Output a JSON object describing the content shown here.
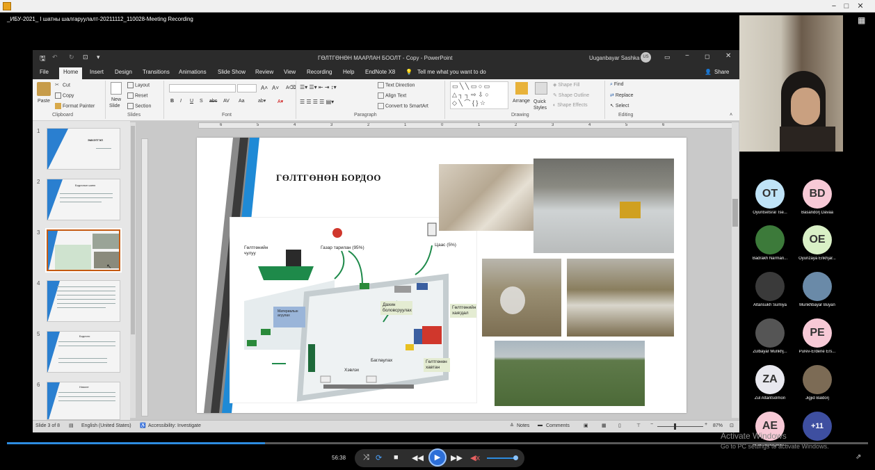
{
  "window": {
    "title_icon": "app-icon",
    "controls": [
      "−",
      "□",
      "✕"
    ]
  },
  "meeting": {
    "title": "_ИБУ-2021_ I шатны шалгаруулалт-20211112_110028-Meeting Recording"
  },
  "ppt": {
    "title": "ГӨЛТГӨНӨН МААРЛАН БООЛТ - Copy - PowerPoint",
    "user": "Uuganbayar Sashka",
    "user_initials": "US",
    "tabs": [
      "File",
      "Home",
      "Insert",
      "Design",
      "Transitions",
      "Animations",
      "Slide Show",
      "Review",
      "View",
      "Recording",
      "Help",
      "EndNote X8"
    ],
    "tell_me": "Tell me what you want to do",
    "share": "Share",
    "ribbon": {
      "clipboard": {
        "paste": "Paste",
        "cut": "Cut",
        "copy": "Copy",
        "format_painter": "Format Painter",
        "group": "Clipboard"
      },
      "slides": {
        "new_slide": "New",
        "new_slide2": "Slide",
        "layout": "Layout",
        "reset": "Reset",
        "section": "Section",
        "group": "Slides"
      },
      "font": {
        "group": "Font",
        "bold": "B",
        "italic": "I",
        "underline": "U",
        "strike": "S",
        "abc": "abc",
        "aa": "Aa"
      },
      "paragraph": {
        "text_direction": "Text Direction",
        "align_text": "Align Text",
        "smartart": "Convert to SmartArt",
        "group": "Paragraph"
      },
      "drawing": {
        "arrange": "Arrange",
        "quick_styles": "Quick Styles",
        "shape_fill": "Shape Fill",
        "shape_outline": "Shape Outline",
        "shape_effects": "Shape Effects",
        "group": "Drawing"
      },
      "editing": {
        "find": "Find",
        "replace": "Replace",
        "select": "Select",
        "group": "Editing"
      }
    },
    "ruler_ticks": [
      "6",
      "5",
      "4",
      "3",
      "2",
      "1",
      "0",
      "1",
      "2",
      "3",
      "4",
      "5",
      "6"
    ],
    "thumbnails": [
      {
        "num": "1",
        "title": "ЭМХЭТГЭЛ"
      },
      {
        "num": "2",
        "title": "Бодлогын шинэ"
      },
      {
        "num": "3",
        "title": ""
      },
      {
        "num": "4",
        "title": ""
      },
      {
        "num": "5",
        "title": "Бодлого"
      },
      {
        "num": "6",
        "title": "Нэмэлт"
      }
    ],
    "slide": {
      "title": "ГӨЛТГӨНӨН БОРДОО",
      "diagram": {
        "stone": "Гөлтгөнийн чулуу",
        "spread": "Газар тарилан (95%)",
        "paper": "Цаас (5%)",
        "recycle": "Дахин боловсруулах",
        "waste": "Гөлтгөнийн хаягдал",
        "factory": "Материалын агуулах",
        "landfill": "Хэвлэх",
        "package": "Баглаулах",
        "board": "Гөлтгөнөн хавтан"
      }
    },
    "status": {
      "slide": "Slide 3 of 8",
      "language": "English (United States)",
      "accessibility": "Accessibility: Investigate",
      "notes": "Notes",
      "comments": "Comments",
      "zoom": "87%"
    }
  },
  "participants": [
    {
      "initials": "OT",
      "name": "Oyuntsetsral  Tse...",
      "color": "#bfe3f7"
    },
    {
      "initials": "BD",
      "name": "Basandorj Davaa",
      "color": "#f7c9d6"
    },
    {
      "initials": "",
      "name": "Badrakh Narman...",
      "color": "#3c7a3a"
    },
    {
      "initials": "OE",
      "name": "Oyunzaya Enkhjar...",
      "color": "#d9f0c6"
    },
    {
      "initials": "",
      "name": "Altansukh Sumiya",
      "color": "#3a3a3a"
    },
    {
      "initials": "",
      "name": "Munkhbayar Buyan",
      "color": "#6a8aa8"
    },
    {
      "initials": "",
      "name": "Zulbayar Munkhj...",
      "color": "#555"
    },
    {
      "initials": "PE",
      "name": "Purev-Erdene Ers...",
      "color": "#f7c9d6"
    },
    {
      "initials": "ZA",
      "name": "Zul Altantsolmon",
      "color": "#e8e8ef"
    },
    {
      "initials": "",
      "name": "Jigjid Baldorj",
      "color": "#7c6b55"
    },
    {
      "initials": "AE",
      "name": "Amarbayasgalan...",
      "color": "#f7c9d6"
    },
    {
      "initials": "+11",
      "name": "",
      "color": "#3e4fa0"
    }
  ],
  "watermark": {
    "line1": "Activate Windows",
    "line2": "Go to PC settings to activate Windows."
  },
  "player": {
    "time": "56:38",
    "progress": 0.3
  }
}
